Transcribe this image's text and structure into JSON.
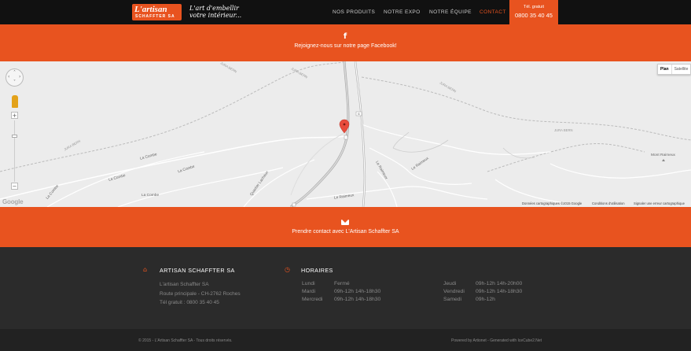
{
  "header": {
    "logo_brand": "L'artisan",
    "logo_sub": "SCHAFFTER SA",
    "tagline": "L'art d'embellir votre intérieur...",
    "nav": [
      {
        "label": "NOS PRODUITS",
        "active": false
      },
      {
        "label": "NOTRE EXPO",
        "active": false
      },
      {
        "label": "NOTRE ÉQUIPE",
        "active": false
      },
      {
        "label": "CONTACT",
        "active": true
      }
    ],
    "phone_label": "Tél. gratuit",
    "phone_number": "0800 35 40 45"
  },
  "facebook_band": {
    "icon": "facebook-icon",
    "text": "Rejoignez-nous sur notre page Facebook!"
  },
  "map": {
    "type_buttons": [
      "Plan",
      "Satellite"
    ],
    "selected_type": "Plan",
    "places": [
      "JURA BERN",
      "JURA BERN",
      "JURA BERN",
      "JURA BERN",
      "JURA BERN",
      "La Combe",
      "La Combe",
      "La Combe",
      "La Combe",
      "La Combe",
      "Quartier Lachaux",
      "Le Raimeux",
      "Le Raimeux",
      "Le Raimeux",
      "Mont Raimeux"
    ],
    "road_badge": "6",
    "google_logo": "Google",
    "attribution": [
      "Données cartographiques ©2015 Google",
      "Conditions d'utilisation",
      "Signaler une erreur cartographique"
    ],
    "marker_color": "#e84b3c"
  },
  "contact_band": {
    "icon": "envelope-icon",
    "text": "Prendre contact avec L'Artisan Schaffter SA"
  },
  "footer": {
    "company": {
      "heading": "ARTISAN SCHAFFTER SA",
      "icon": "home-icon",
      "lines": [
        "L'artisan Schaffter SA",
        "Route principale - CH-2762 Roches",
        "Tél gratuit : 0800 35 40 45"
      ]
    },
    "hours": {
      "heading": "HORAIRES",
      "icon": "clock-icon",
      "left": [
        {
          "day": "Lundi",
          "time": "Fermé"
        },
        {
          "day": "Mardi",
          "time": "09h-12h 14h-18h30"
        },
        {
          "day": "Mercredi",
          "time": "09h-12h 14h-18h30"
        }
      ],
      "right": [
        {
          "day": "Jeudi",
          "time": "09h-12h 14h-20h00"
        },
        {
          "day": "Vendredi",
          "time": "09h-12h 14h-18h30"
        },
        {
          "day": "Samedi",
          "time": "09h-12h"
        }
      ]
    }
  },
  "bottom": {
    "copyright": "© 2015 - L'Artisan Schaffter SA - Tous droits réservés.",
    "powered": "Powered by Artionet - Generated with IceCube2.Net"
  },
  "colors": {
    "accent": "#e8531f",
    "dark": "#111111",
    "footer": "#2b2b2b"
  }
}
